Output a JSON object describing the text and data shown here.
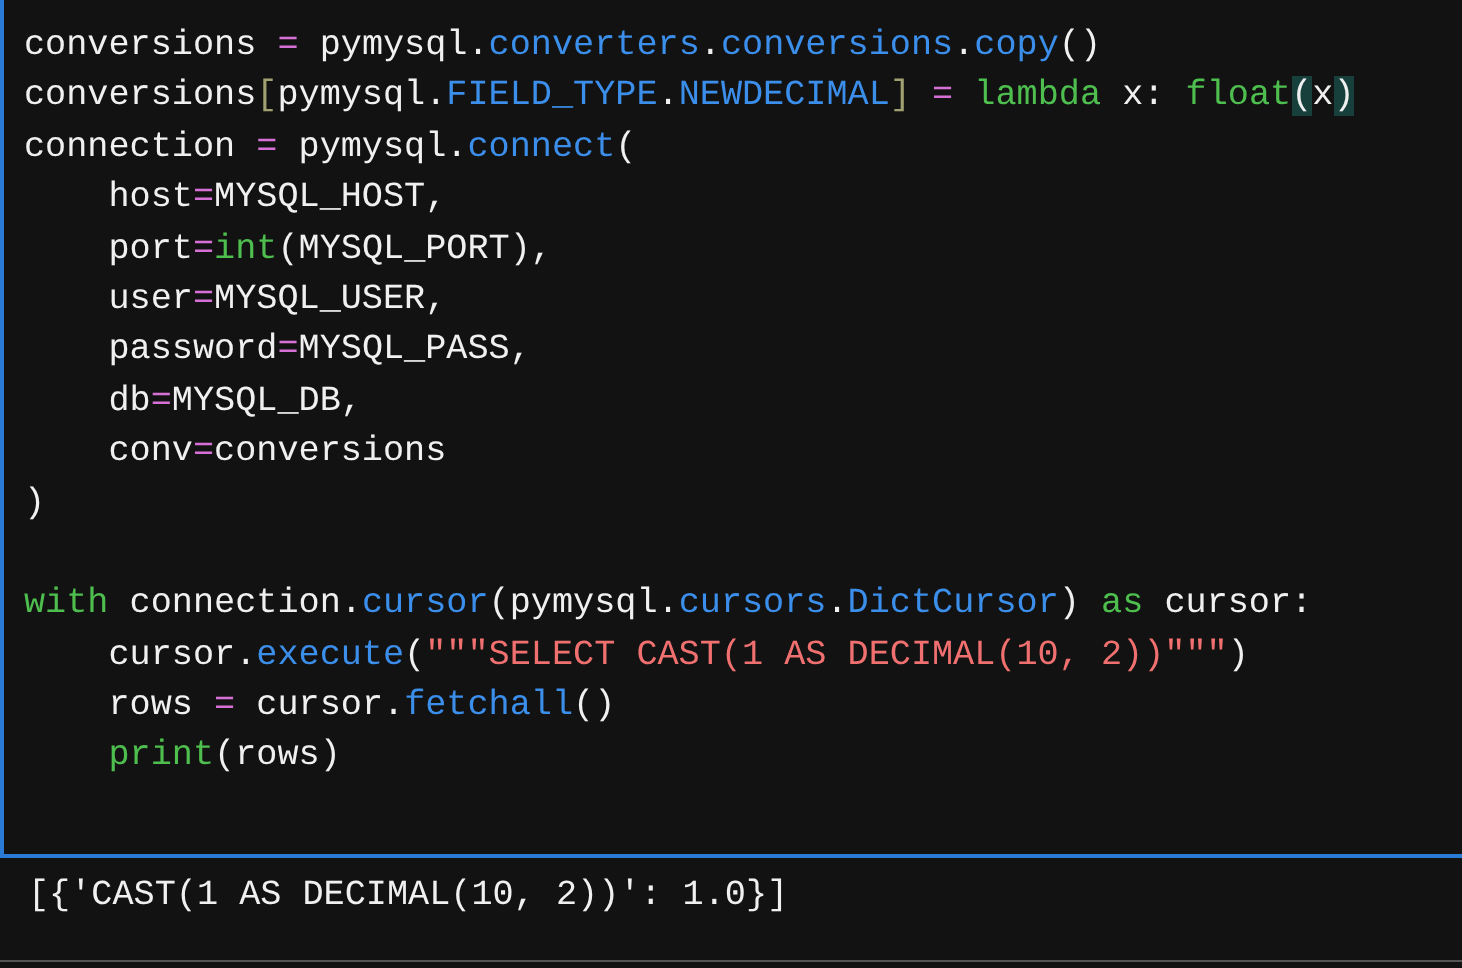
{
  "code_cell": {
    "lines": [
      {
        "kind": "code",
        "tokens": [
          {
            "text": "conversions ",
            "kind": "plain"
          },
          {
            "text": "=",
            "kind": "operator"
          },
          {
            "text": " pymysql.",
            "kind": "plain"
          },
          {
            "text": "converters",
            "kind": "attribute"
          },
          {
            "text": ".",
            "kind": "plain"
          },
          {
            "text": "conversions",
            "kind": "attribute"
          },
          {
            "text": ".",
            "kind": "plain"
          },
          {
            "text": "copy",
            "kind": "attribute"
          },
          {
            "text": "()",
            "kind": "plain"
          }
        ]
      },
      {
        "kind": "code",
        "tokens": [
          {
            "text": "conversions",
            "kind": "plain"
          },
          {
            "text": "[",
            "kind": "bracket"
          },
          {
            "text": "pymysql.",
            "kind": "plain"
          },
          {
            "text": "FIELD_TYPE",
            "kind": "attribute"
          },
          {
            "text": ".",
            "kind": "plain"
          },
          {
            "text": "NEWDECIMAL",
            "kind": "attribute"
          },
          {
            "text": "]",
            "kind": "bracket"
          },
          {
            "text": " = ",
            "kind": "operator"
          },
          {
            "text": "lambda",
            "kind": "keyword"
          },
          {
            "text": " x: ",
            "kind": "plain"
          },
          {
            "text": "float",
            "kind": "keyword"
          },
          {
            "text": "(",
            "kind": "match"
          },
          {
            "text": "x",
            "kind": "plain"
          },
          {
            "text": ")",
            "kind": "match"
          }
        ]
      },
      {
        "kind": "code",
        "tokens": [
          {
            "text": "connection ",
            "kind": "plain"
          },
          {
            "text": "=",
            "kind": "operator"
          },
          {
            "text": " pymysql.",
            "kind": "plain"
          },
          {
            "text": "connect",
            "kind": "attribute"
          },
          {
            "text": "(",
            "kind": "plain"
          }
        ]
      },
      {
        "kind": "code",
        "tokens": [
          {
            "text": "    host",
            "kind": "plain"
          },
          {
            "text": "=",
            "kind": "operator"
          },
          {
            "text": "MYSQL_HOST,",
            "kind": "plain"
          }
        ]
      },
      {
        "kind": "code",
        "tokens": [
          {
            "text": "    port",
            "kind": "plain"
          },
          {
            "text": "=",
            "kind": "operator"
          },
          {
            "text": "int",
            "kind": "keyword"
          },
          {
            "text": "(MYSQL_PORT),",
            "kind": "plain"
          }
        ]
      },
      {
        "kind": "code",
        "tokens": [
          {
            "text": "    user",
            "kind": "plain"
          },
          {
            "text": "=",
            "kind": "operator"
          },
          {
            "text": "MYSQL_USER,",
            "kind": "plain"
          }
        ]
      },
      {
        "kind": "code",
        "tokens": [
          {
            "text": "    password",
            "kind": "plain"
          },
          {
            "text": "=",
            "kind": "operator"
          },
          {
            "text": "MYSQL_PASS,",
            "kind": "plain"
          }
        ]
      },
      {
        "kind": "code",
        "tokens": [
          {
            "text": "    db",
            "kind": "plain"
          },
          {
            "text": "=",
            "kind": "operator"
          },
          {
            "text": "MYSQL_DB,",
            "kind": "plain"
          }
        ]
      },
      {
        "kind": "code",
        "tokens": [
          {
            "text": "    conv",
            "kind": "plain"
          },
          {
            "text": "=",
            "kind": "operator"
          },
          {
            "text": "conversions",
            "kind": "plain"
          }
        ]
      },
      {
        "kind": "code",
        "tokens": [
          {
            "text": ")",
            "kind": "plain"
          }
        ]
      },
      {
        "kind": "blank"
      },
      {
        "kind": "code",
        "tokens": [
          {
            "text": "with",
            "kind": "keyword"
          },
          {
            "text": " connection.",
            "kind": "plain"
          },
          {
            "text": "cursor",
            "kind": "attribute"
          },
          {
            "text": "(pymysql.",
            "kind": "plain"
          },
          {
            "text": "cursors",
            "kind": "attribute"
          },
          {
            "text": ".",
            "kind": "plain"
          },
          {
            "text": "DictCursor",
            "kind": "attribute"
          },
          {
            "text": ") ",
            "kind": "plain"
          },
          {
            "text": "as",
            "kind": "keyword"
          },
          {
            "text": " cursor:",
            "kind": "plain"
          }
        ]
      },
      {
        "kind": "code",
        "tokens": [
          {
            "text": "    cursor.",
            "kind": "plain"
          },
          {
            "text": "execute",
            "kind": "attribute"
          },
          {
            "text": "(",
            "kind": "plain"
          },
          {
            "text": "\"\"\"SELECT CAST(1 AS DECIMAL(10, 2))\"\"\"",
            "kind": "string"
          },
          {
            "text": ")",
            "kind": "plain"
          }
        ]
      },
      {
        "kind": "code",
        "tokens": [
          {
            "text": "    rows ",
            "kind": "plain"
          },
          {
            "text": "=",
            "kind": "operator"
          },
          {
            "text": " cursor.",
            "kind": "plain"
          },
          {
            "text": "fetchall",
            "kind": "attribute"
          },
          {
            "text": "()",
            "kind": "plain"
          }
        ]
      },
      {
        "kind": "code",
        "tokens": [
          {
            "text": "    print",
            "kind": "keyword"
          },
          {
            "text": "(rows)",
            "kind": "plain"
          }
        ]
      }
    ]
  },
  "output": {
    "text": "[{'CAST(1 AS DECIMAL(10, 2))': 1.0}]"
  }
}
